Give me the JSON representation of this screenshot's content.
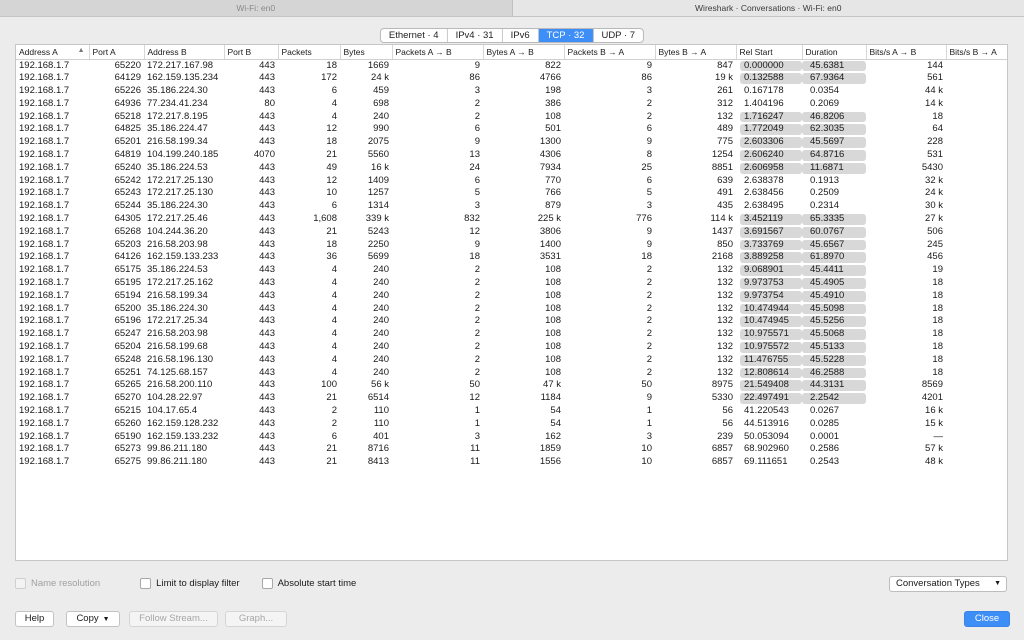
{
  "window_tabs": [
    "Wi-Fi: en0",
    "Wireshark · Conversations · Wi-Fi: en0"
  ],
  "segments": [
    "Ethernet · 4",
    "IPv4 · 31",
    "IPv6",
    "TCP · 32",
    "UDP · 7"
  ],
  "selected_segment": "TCP · 32",
  "columns": [
    "Address A",
    "Port A",
    "Address B",
    "Port B",
    "Packets",
    "Bytes",
    "Packets A → B",
    "Bytes A → B",
    "Packets B → A",
    "Bytes B → A",
    "Rel Start",
    "Duration",
    "Bits/s A → B",
    "Bits/s B → A"
  ],
  "rows": [
    [
      "192.168.1.7",
      "65220",
      "172.217.167.98",
      "443",
      "18",
      "1669",
      "9",
      "822",
      "9",
      "847",
      "0.000000",
      "45.6381",
      "144",
      ""
    ],
    [
      "192.168.1.7",
      "64129",
      "162.159.135.234",
      "443",
      "172",
      "24 k",
      "86",
      "4766",
      "86",
      "19 k",
      "0.132588",
      "67.9364",
      "561",
      "2"
    ],
    [
      "192.168.1.7",
      "65226",
      "35.186.224.30",
      "443",
      "6",
      "459",
      "3",
      "198",
      "3",
      "261",
      "0.167178",
      "0.0354",
      "44 k",
      ""
    ],
    [
      "192.168.1.7",
      "64936",
      "77.234.41.234",
      "80",
      "4",
      "698",
      "2",
      "386",
      "2",
      "312",
      "1.404196",
      "0.2069",
      "14 k",
      ""
    ],
    [
      "192.168.1.7",
      "65218",
      "172.217.8.195",
      "443",
      "4",
      "240",
      "2",
      "108",
      "2",
      "132",
      "1.716247",
      "46.8206",
      "18",
      ""
    ],
    [
      "192.168.1.7",
      "64825",
      "35.186.224.47",
      "443",
      "12",
      "990",
      "6",
      "501",
      "6",
      "489",
      "1.772049",
      "62.3035",
      "64",
      ""
    ],
    [
      "192.168.1.7",
      "65201",
      "216.58.199.34",
      "443",
      "18",
      "2075",
      "9",
      "1300",
      "9",
      "775",
      "2.603306",
      "45.5697",
      "228",
      ""
    ],
    [
      "192.168.1.7",
      "64819",
      "104.199.240.185",
      "4070",
      "21",
      "5560",
      "13",
      "4306",
      "8",
      "1254",
      "2.606240",
      "64.8716",
      "531",
      ""
    ],
    [
      "192.168.1.7",
      "65240",
      "35.186.224.53",
      "443",
      "49",
      "16 k",
      "24",
      "7934",
      "25",
      "8851",
      "2.606958",
      "11.6871",
      "5430",
      "6"
    ],
    [
      "192.168.1.7",
      "65242",
      "172.217.25.130",
      "443",
      "12",
      "1409",
      "6",
      "770",
      "6",
      "639",
      "2.638378",
      "0.1913",
      "32 k",
      ""
    ],
    [
      "192.168.1.7",
      "65243",
      "172.217.25.130",
      "443",
      "10",
      "1257",
      "5",
      "766",
      "5",
      "491",
      "2.638456",
      "0.2509",
      "24 k",
      ""
    ],
    [
      "192.168.1.7",
      "65244",
      "35.186.224.30",
      "443",
      "6",
      "1314",
      "3",
      "879",
      "3",
      "435",
      "2.638495",
      "0.2314",
      "30 k",
      ""
    ],
    [
      "192.168.1.7",
      "64305",
      "172.217.25.46",
      "443",
      "1,608",
      "339 k",
      "832",
      "225 k",
      "776",
      "114 k",
      "3.452119",
      "65.3335",
      "27 k",
      ""
    ],
    [
      "192.168.1.7",
      "65268",
      "104.244.36.20",
      "443",
      "21",
      "5243",
      "12",
      "3806",
      "9",
      "1437",
      "3.691567",
      "60.0767",
      "506",
      ""
    ],
    [
      "192.168.1.7",
      "65203",
      "216.58.203.98",
      "443",
      "18",
      "2250",
      "9",
      "1400",
      "9",
      "850",
      "3.733769",
      "45.6567",
      "245",
      ""
    ],
    [
      "192.168.1.7",
      "64126",
      "162.159.133.233",
      "443",
      "36",
      "5699",
      "18",
      "3531",
      "18",
      "2168",
      "3.889258",
      "61.8970",
      "456",
      ""
    ],
    [
      "192.168.1.7",
      "65175",
      "35.186.224.53",
      "443",
      "4",
      "240",
      "2",
      "108",
      "2",
      "132",
      "9.068901",
      "45.4411",
      "19",
      ""
    ],
    [
      "192.168.1.7",
      "65195",
      "172.217.25.162",
      "443",
      "4",
      "240",
      "2",
      "108",
      "2",
      "132",
      "9.973753",
      "45.4905",
      "18",
      ""
    ],
    [
      "192.168.1.7",
      "65194",
      "216.58.199.34",
      "443",
      "4",
      "240",
      "2",
      "108",
      "2",
      "132",
      "9.973754",
      "45.4910",
      "18",
      ""
    ],
    [
      "192.168.1.7",
      "65200",
      "35.186.224.30",
      "443",
      "4",
      "240",
      "2",
      "108",
      "2",
      "132",
      "10.474944",
      "45.5098",
      "18",
      ""
    ],
    [
      "192.168.1.7",
      "65196",
      "172.217.25.34",
      "443",
      "4",
      "240",
      "2",
      "108",
      "2",
      "132",
      "10.474945",
      "45.5256",
      "18",
      ""
    ],
    [
      "192.168.1.7",
      "65247",
      "216.58.203.98",
      "443",
      "4",
      "240",
      "2",
      "108",
      "2",
      "132",
      "10.975571",
      "45.5068",
      "18",
      ""
    ],
    [
      "192.168.1.7",
      "65204",
      "216.58.199.68",
      "443",
      "4",
      "240",
      "2",
      "108",
      "2",
      "132",
      "10.975572",
      "45.5133",
      "18",
      ""
    ],
    [
      "192.168.1.7",
      "65248",
      "216.58.196.130",
      "443",
      "4",
      "240",
      "2",
      "108",
      "2",
      "132",
      "11.476755",
      "45.5228",
      "18",
      ""
    ],
    [
      "192.168.1.7",
      "65251",
      "74.125.68.157",
      "443",
      "4",
      "240",
      "2",
      "108",
      "2",
      "132",
      "12.808614",
      "46.2588",
      "18",
      ""
    ],
    [
      "192.168.1.7",
      "65265",
      "216.58.200.110",
      "443",
      "100",
      "56 k",
      "50",
      "47 k",
      "50",
      "8975",
      "21.549408",
      "44.3131",
      "8569",
      "1"
    ],
    [
      "192.168.1.7",
      "65270",
      "104.28.22.97",
      "443",
      "21",
      "6514",
      "12",
      "1184",
      "9",
      "5330",
      "22.497491",
      "2.2542",
      "4201",
      ""
    ],
    [
      "192.168.1.7",
      "65215",
      "104.17.65.4",
      "443",
      "2",
      "110",
      "1",
      "54",
      "1",
      "56",
      "41.220543",
      "0.0267",
      "16 k",
      ""
    ],
    [
      "192.168.1.7",
      "65260",
      "162.159.128.232",
      "443",
      "2",
      "110",
      "1",
      "54",
      "1",
      "56",
      "44.513916",
      "0.0285",
      "15 k",
      ""
    ],
    [
      "192.168.1.7",
      "65190",
      "162.159.133.232",
      "443",
      "6",
      "401",
      "3",
      "162",
      "3",
      "239",
      "50.053094",
      "0.0001",
      "—",
      ""
    ],
    [
      "192.168.1.7",
      "65273",
      "99.86.211.180",
      "443",
      "21",
      "8716",
      "11",
      "1859",
      "10",
      "6857",
      "68.902960",
      "0.2586",
      "57 k",
      "2"
    ],
    [
      "192.168.1.7",
      "65275",
      "99.86.211.180",
      "443",
      "21",
      "8413",
      "11",
      "1556",
      "10",
      "6857",
      "69.111651",
      "0.2543",
      "48 k",
      "2"
    ]
  ],
  "options": {
    "name_resolution": "Name resolution",
    "limit_filter": "Limit to display filter",
    "absolute_start": "Absolute start time",
    "conversation_types": "Conversation Types"
  },
  "buttons": {
    "help": "Help",
    "copy": "Copy",
    "follow_stream": "Follow Stream...",
    "graph": "Graph...",
    "close": "Close"
  },
  "colors": {
    "accent": "#3e8ef7",
    "bar": "#d8d8d8"
  }
}
